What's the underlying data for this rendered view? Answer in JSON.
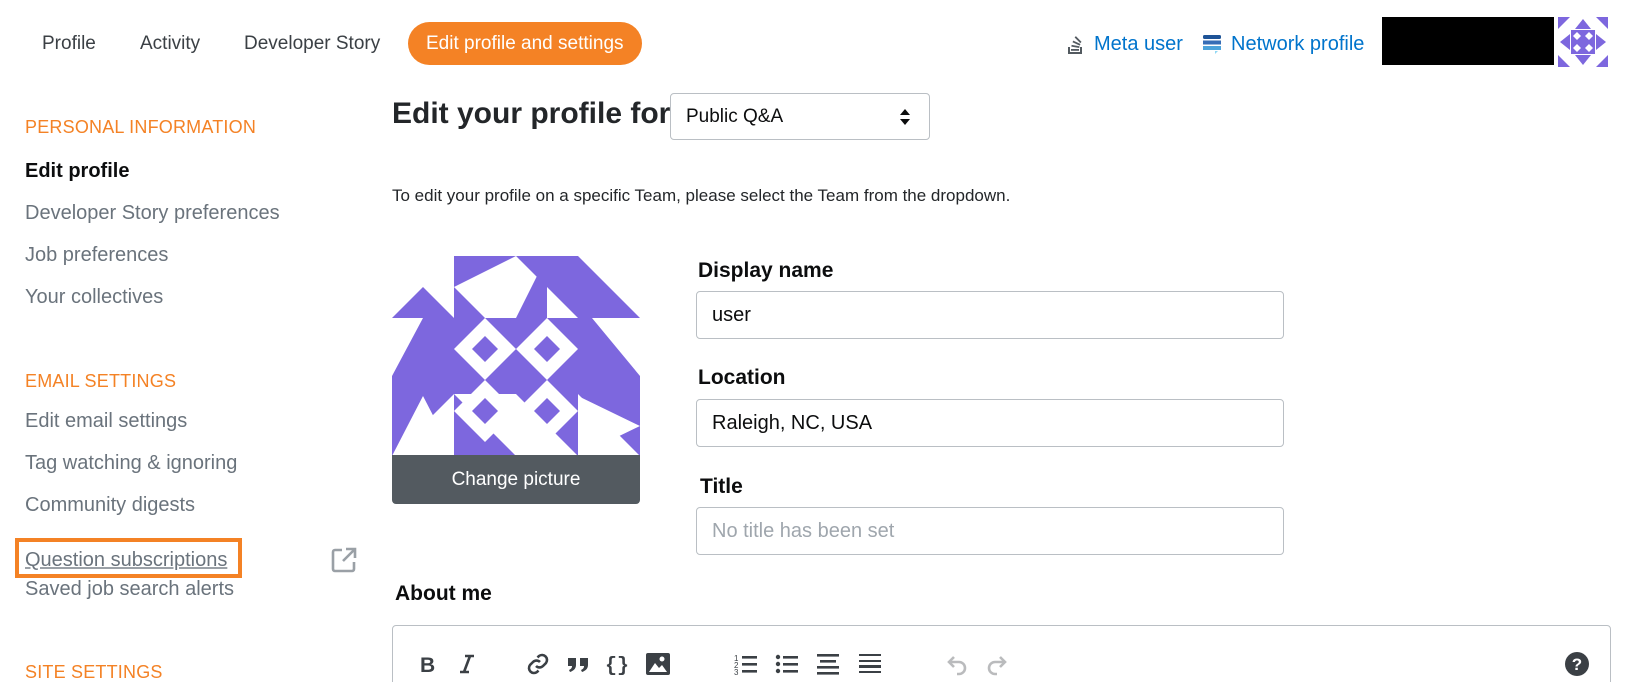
{
  "nav": {
    "tabs": [
      {
        "label": "Profile"
      },
      {
        "label": "Activity"
      },
      {
        "label": "Developer Story"
      },
      {
        "label": "Edit profile and settings",
        "active": true
      }
    ],
    "meta_user": "Meta user",
    "network_profile": "Network profile",
    "link_color": "#0074cc",
    "accent": "#f48225"
  },
  "sidebar": {
    "personal_heading": "PERSONAL INFORMATION",
    "personal_items": [
      "Edit profile",
      "Developer Story preferences",
      "Job preferences",
      "Your collectives"
    ],
    "email_heading": "EMAIL SETTINGS",
    "email_items": [
      "Edit email settings",
      "Tag watching & ignoring",
      "Community digests",
      "Question subscriptions",
      "Saved job search alerts"
    ],
    "site_heading": "SITE SETTINGS"
  },
  "main": {
    "title": "Edit your profile for",
    "select_value": "Public Q&A",
    "help_text": "To edit your profile on a specific Team, please select the Team from the dropdown.",
    "change_picture": "Change picture",
    "display_name_label": "Display name",
    "display_name_value": "user",
    "location_label": "Location",
    "location_value": "Raleigh, NC, USA",
    "title_label": "Title",
    "title_placeholder": "No title has been set",
    "about_label": "About me",
    "avatar_color": "#7d67de"
  },
  "toolbar_icons": [
    "bold-icon",
    "italic-icon",
    "link-icon",
    "quote-icon",
    "code-icon",
    "image-icon",
    "ordered-list-icon",
    "unordered-list-icon",
    "heading-icon",
    "horizontal-rule-icon",
    "undo-icon",
    "redo-icon",
    "help-icon"
  ]
}
